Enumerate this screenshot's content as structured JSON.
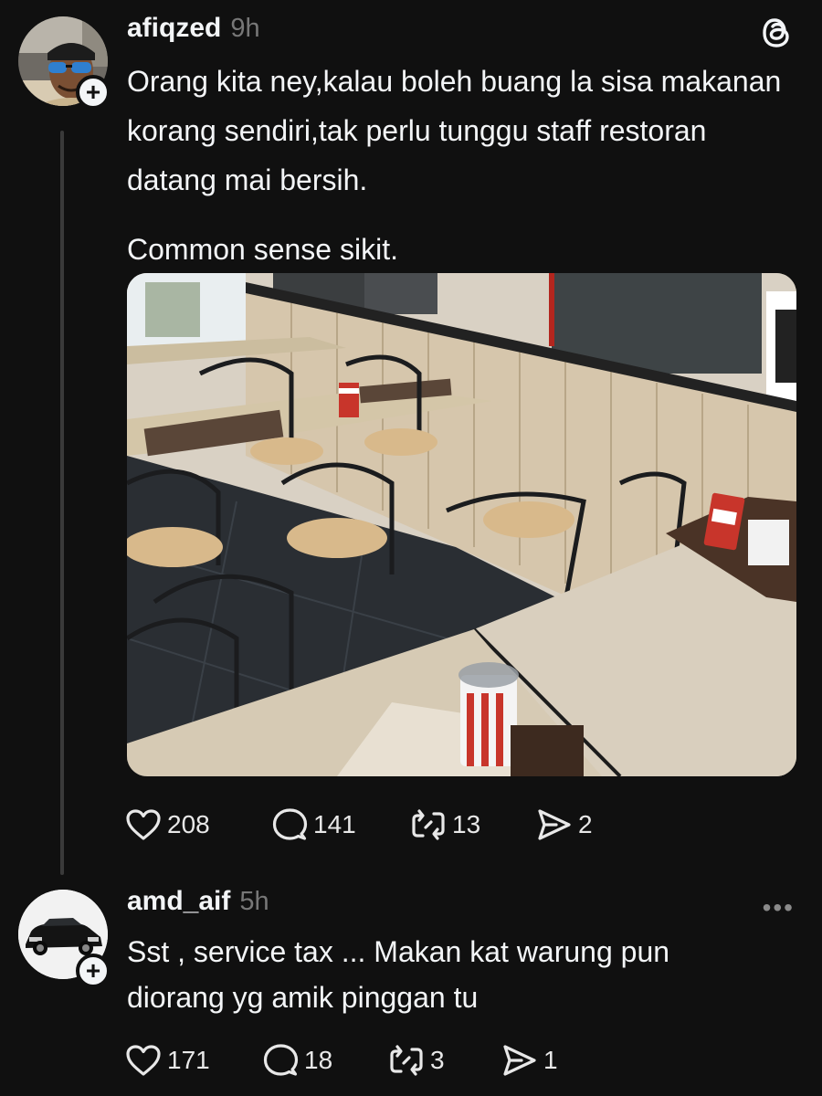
{
  "app": {
    "logo_icon": "threads-logo-icon"
  },
  "post": {
    "username": "afiqzed",
    "timestamp": "9h",
    "text_paragraphs": [
      "Orang kita ney,kalau boleh buang la sisa makanan korang sendiri,tak perlu tunggu staff restoran datang mai bersih.",
      "Common sense sikit."
    ],
    "image_description_icon": "restaurant-photo",
    "actions": {
      "likes": "208",
      "replies": "141",
      "reposts": "13",
      "shares": "2"
    }
  },
  "reply": {
    "username": "amd_aif",
    "timestamp": "5h",
    "text_lines": [
      "Sst , service tax ... Makan kat warung pun",
      "diorang yg amik pinggan tu"
    ],
    "more_label": "•••",
    "actions": {
      "likes": "171",
      "replies": "18",
      "reposts": "3",
      "shares": "1"
    }
  },
  "colors": {
    "background": "#101010",
    "text": "#f3f5f7",
    "muted": "#777777"
  }
}
